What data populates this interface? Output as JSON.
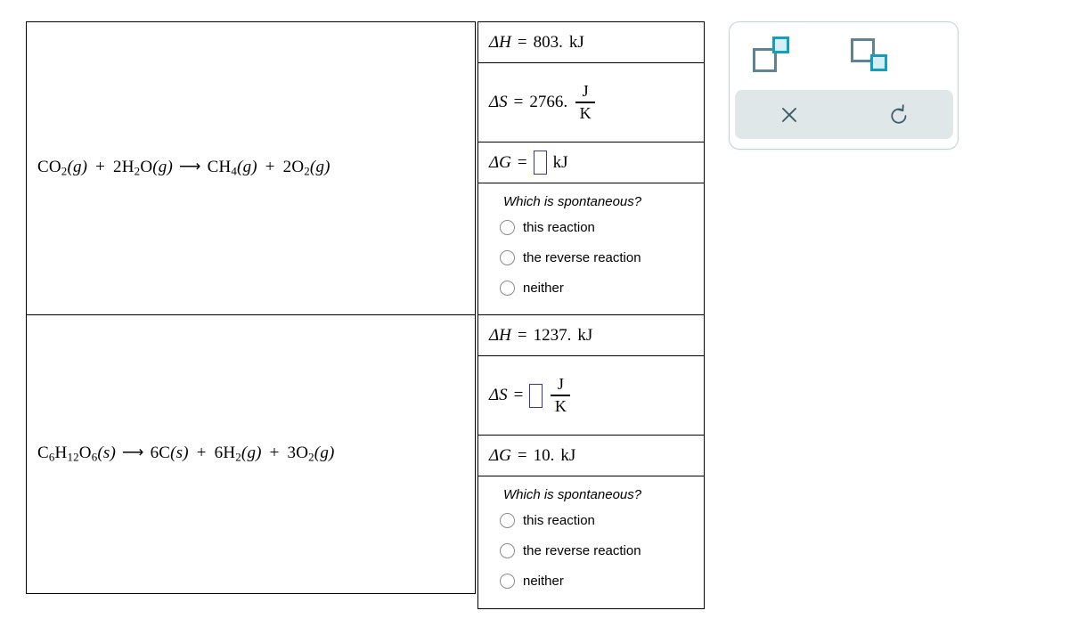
{
  "table": {
    "rows": [
      {
        "reaction": {
          "html_parts": [
            {
              "t": "CO",
              "sub": "2"
            },
            {
              "t": "(g)",
              "italic_paren": true
            },
            {
              "t": "+"
            },
            {
              "t": "2H",
              "sub": "2"
            },
            {
              "t": "O"
            },
            {
              "t": "(g)",
              "italic_paren": true
            },
            {
              "t": "→"
            },
            {
              "t": "CH",
              "sub": "4"
            },
            {
              "t": "(g)",
              "italic_paren": true
            },
            {
              "t": "+"
            },
            {
              "t": "2O",
              "sub": "2"
            },
            {
              "t": "(g)",
              "italic_paren": true
            }
          ],
          "plain": "CO2(g) + 2H2O(g) → CH4(g) + 2O2(g)"
        },
        "delta_h": {
          "symbol": "ΔH",
          "equals": "=",
          "value": "803.",
          "unit": "kJ",
          "is_input": false
        },
        "delta_s": {
          "symbol": "ΔS",
          "equals": "=",
          "value": "2766.",
          "unit_numerator": "J",
          "unit_denominator": "K",
          "is_input": false
        },
        "delta_g": {
          "symbol": "ΔG",
          "equals": "=",
          "value": "",
          "unit": "kJ",
          "is_input": true
        },
        "question": {
          "prompt": "Which is spontaneous?",
          "options": [
            "this reaction",
            "the reverse reaction",
            "neither"
          ],
          "selected": null
        }
      },
      {
        "reaction": {
          "html_parts": [
            {
              "t": "C",
              "sub": "6"
            },
            {
              "t": "H",
              "sub": "12"
            },
            {
              "t": "O",
              "sub": "6"
            },
            {
              "t": "(s)",
              "italic_paren": true
            },
            {
              "t": "→"
            },
            {
              "t": "6C"
            },
            {
              "t": "(s)",
              "italic_paren": true
            },
            {
              "t": "+"
            },
            {
              "t": "6H",
              "sub": "2"
            },
            {
              "t": "(g)",
              "italic_paren": true
            },
            {
              "t": "+"
            },
            {
              "t": "3O",
              "sub": "2"
            },
            {
              "t": "(g)",
              "italic_paren": true
            }
          ],
          "plain": "C6H12O6(s) → 6C(s) + 6H2(g) + 3O2(g)"
        },
        "delta_h": {
          "symbol": "ΔH",
          "equals": "=",
          "value": "1237.",
          "unit": "kJ",
          "is_input": false
        },
        "delta_s": {
          "symbol": "ΔS",
          "equals": "=",
          "value": "",
          "unit_numerator": "J",
          "unit_denominator": "K",
          "is_input": true
        },
        "delta_g": {
          "symbol": "ΔG",
          "equals": "=",
          "value": "10.",
          "unit": "kJ",
          "is_input": false
        },
        "question": {
          "prompt": "Which is spontaneous?",
          "options": [
            "this reaction",
            "the reverse reaction",
            "neither"
          ],
          "selected": null
        }
      }
    ]
  },
  "math_toolbar": {
    "icons": [
      {
        "name": "superscript-icon",
        "label": "superscript"
      },
      {
        "name": "subscript-icon",
        "label": "subscript"
      }
    ],
    "actions": [
      {
        "name": "clear-icon",
        "label": "clear"
      },
      {
        "name": "undo-icon",
        "label": "undo"
      }
    ],
    "colors": {
      "panel_border": "#c3d0d6",
      "bar_background": "#dfe7e9",
      "icon_big_square": "#5e8494",
      "icon_small_square": "#0f9fc4",
      "icon_small_fill": "#d6eef5",
      "action_icon": "#3c5c68",
      "input_border": "#3333cc"
    }
  }
}
